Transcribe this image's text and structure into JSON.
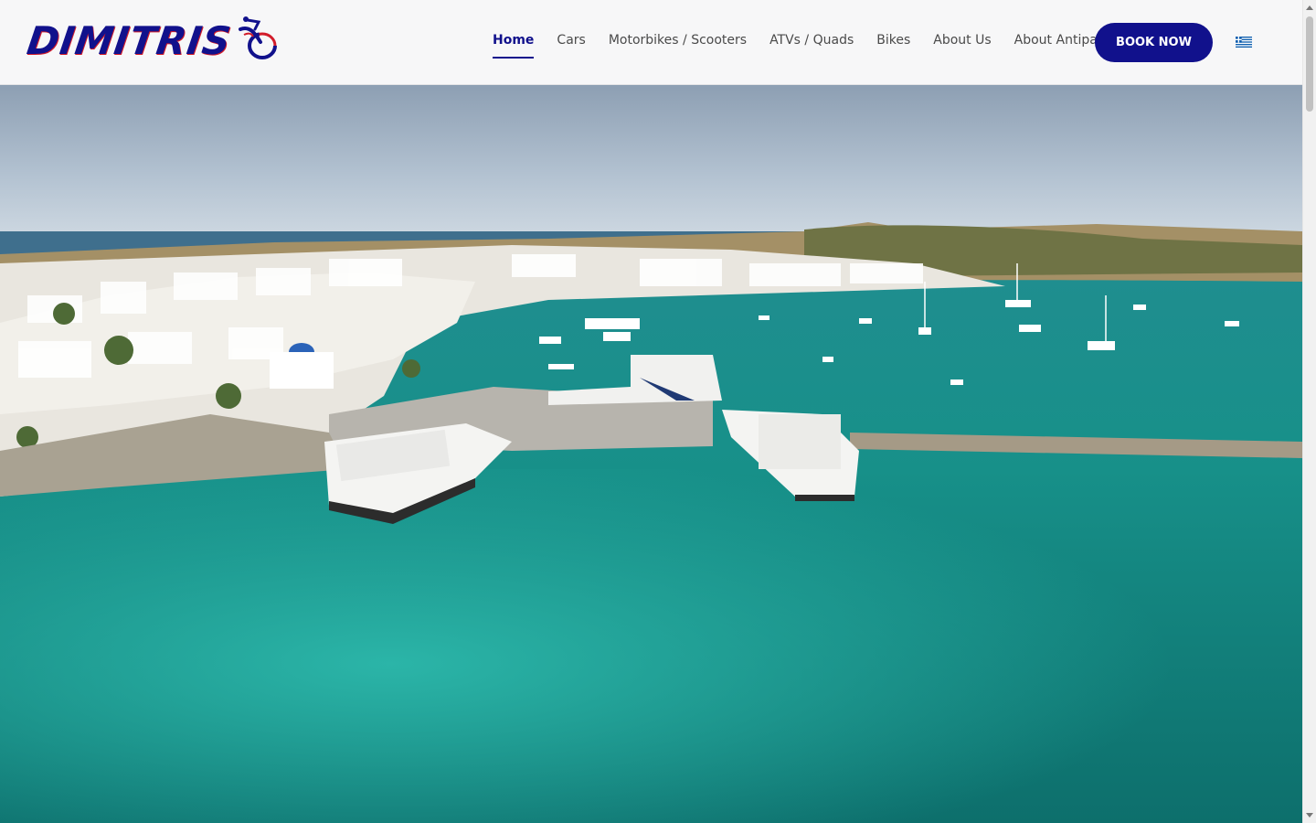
{
  "brand": {
    "name": "DIMITRIS"
  },
  "nav": {
    "items": [
      {
        "label": "Home",
        "active": true
      },
      {
        "label": "Cars"
      },
      {
        "label": "Motorbikes / Scooters"
      },
      {
        "label": "ATVs / Quads"
      },
      {
        "label": "Bikes"
      },
      {
        "label": "About Us"
      },
      {
        "label": "About Antiparos"
      }
    ],
    "cta_label": "BOOK NOW",
    "language_icon": "greek-flag-icon"
  },
  "hero": {
    "image": "aerial-harbor-photo"
  },
  "colors": {
    "brand_blue": "#11118c",
    "brand_red": "#d21c2a",
    "header_bg": "#f7f7f8"
  }
}
